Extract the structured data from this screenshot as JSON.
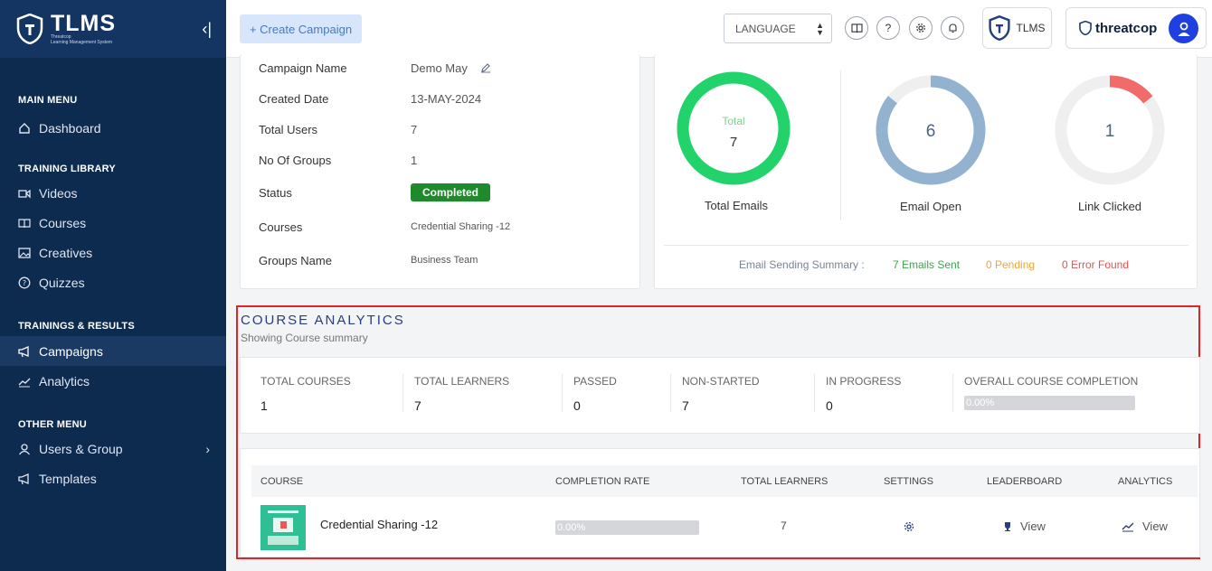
{
  "brand": {
    "name": "TLMS",
    "sub1": "Threatcop",
    "sub2": "Learning Management System"
  },
  "sidebar": {
    "sections": [
      {
        "title": "MAIN MENU",
        "items": [
          {
            "label": "Dashboard",
            "icon": "home-icon"
          }
        ]
      },
      {
        "title": "TRAINING LIBRARY",
        "items": [
          {
            "label": "Videos",
            "icon": "video-icon"
          },
          {
            "label": "Courses",
            "icon": "book-icon"
          },
          {
            "label": "Creatives",
            "icon": "image-icon"
          },
          {
            "label": "Quizzes",
            "icon": "question-icon"
          }
        ]
      },
      {
        "title": "TRAININGS & RESULTS",
        "items": [
          {
            "label": "Campaigns",
            "icon": "megaphone-icon",
            "active": true
          },
          {
            "label": "Analytics",
            "icon": "trend-icon"
          }
        ]
      },
      {
        "title": "OTHER MENU",
        "items": [
          {
            "label": "Users & Group",
            "icon": "user-icon"
          },
          {
            "label": "Templates",
            "icon": "megaphone-icon"
          }
        ]
      }
    ]
  },
  "topbar": {
    "create_label": "+ Create Campaign",
    "language_label": "LANGUAGE",
    "tlms_label": "TLMS",
    "org_name": "threatcop"
  },
  "campaign": {
    "rows": [
      {
        "label": "Campaign Name",
        "value": "Demo May"
      },
      {
        "label": "Created Date",
        "value": "13-MAY-2024"
      },
      {
        "label": "Total Users",
        "value": "7"
      },
      {
        "label": "No Of Groups",
        "value": "1"
      },
      {
        "label": "Status",
        "value": "Completed"
      },
      {
        "label": "Courses",
        "value": "Credential Sharing -12"
      },
      {
        "label": "Groups Name",
        "value": "Business Team"
      }
    ]
  },
  "emails": {
    "donuts": [
      {
        "label": "Total Emails",
        "inner_label": "Total",
        "value": "7",
        "fraction": 1.0,
        "color": "#22d36b"
      },
      {
        "label": "Email Open",
        "value": "6",
        "fraction": 0.857,
        "color": "#93b2cf"
      },
      {
        "label": "Link Clicked",
        "value": "1",
        "fraction": 0.143,
        "color": "#f26b6b"
      }
    ],
    "summary_label": "Email Sending Summary :",
    "sent": "7 Emails Sent",
    "pending": "0 Pending",
    "error": "0 Error Found",
    "colors": {
      "sent": "#3da34d",
      "pending": "#f0a63a",
      "error": "#e05353"
    }
  },
  "analytics": {
    "title": "COURSE ANALYTICS",
    "subtitle": "Showing Course summary",
    "totals": [
      {
        "label": "TOTAL COURSES",
        "value": "1"
      },
      {
        "label": "TOTAL LEARNERS",
        "value": "7"
      },
      {
        "label": "PASSED",
        "value": "0"
      },
      {
        "label": "NON-STARTED",
        "value": "7"
      },
      {
        "label": "IN PROGRESS",
        "value": "0"
      },
      {
        "label": "OVERALL COURSE COMPLETION",
        "value": "0.00%"
      }
    ],
    "table": {
      "headers": [
        "COURSE",
        "COMPLETION RATE",
        "TOTAL LEARNERS",
        "SETTINGS",
        "LEADERBOARD",
        "ANALYTICS"
      ],
      "rows": [
        {
          "course": "Credential Sharing -12",
          "completion": "0.00%",
          "learners": "7",
          "leaderboard": "View",
          "analytics": "View"
        }
      ]
    }
  }
}
